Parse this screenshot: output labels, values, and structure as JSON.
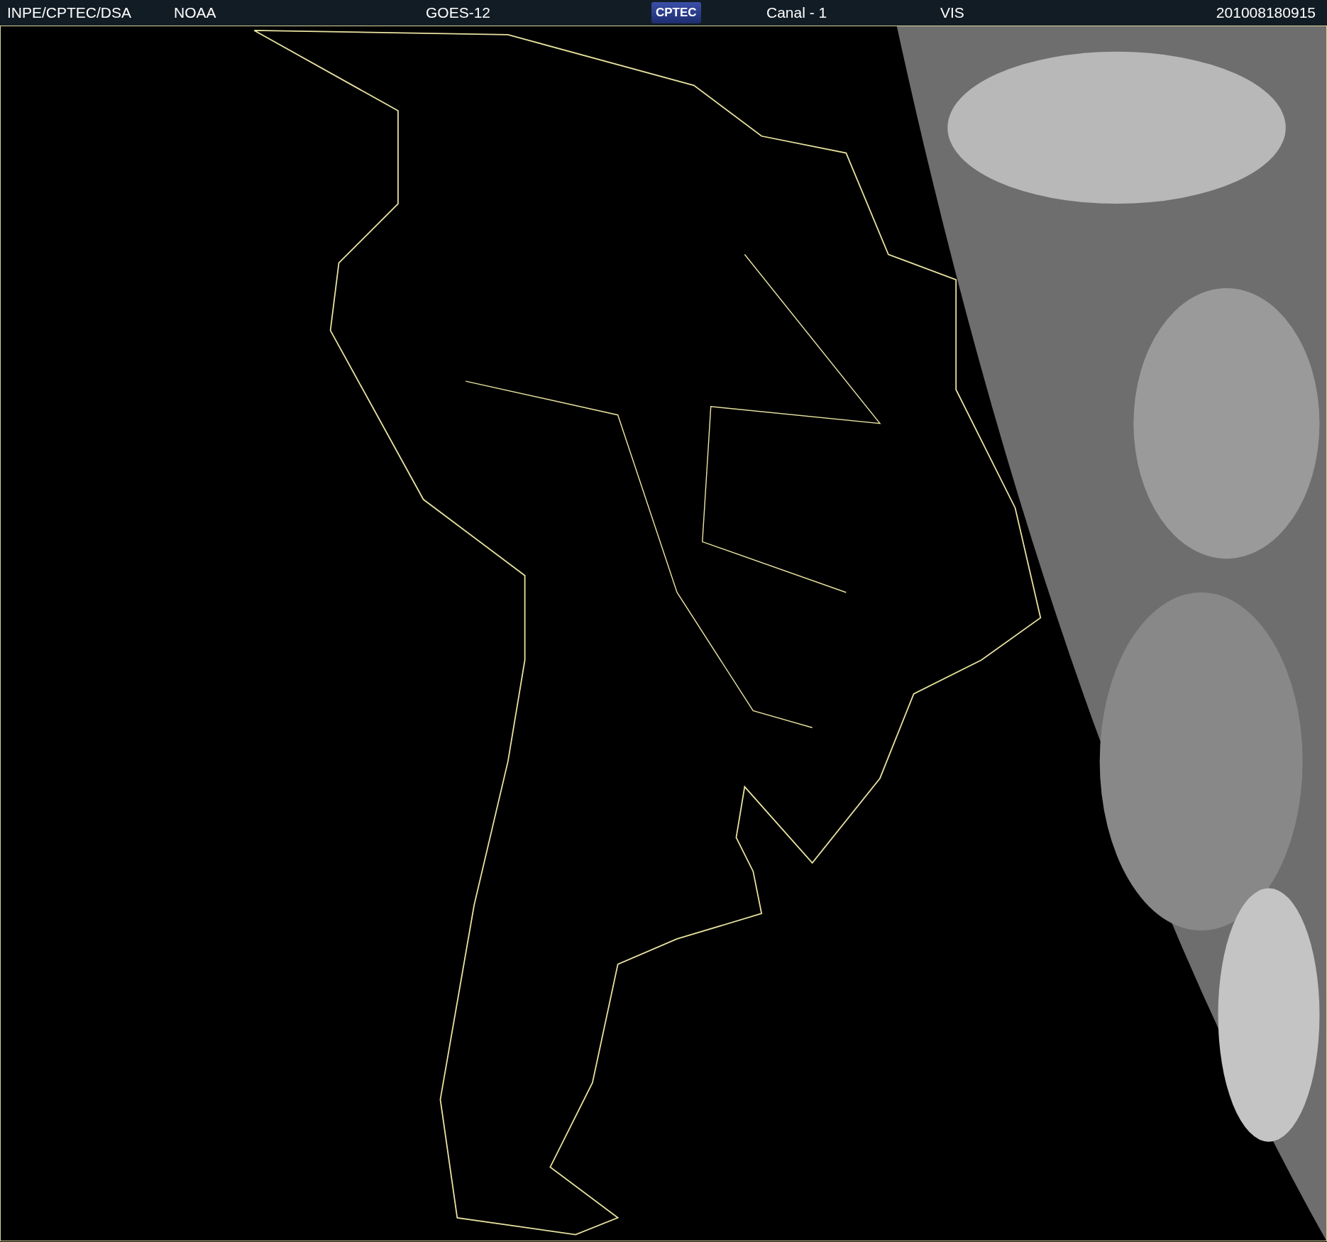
{
  "header": [
    {
      "kind": "text",
      "text": "INPE/CPTEC/DSA"
    },
    {
      "kind": "text",
      "text": "NOAA"
    },
    {
      "kind": "text",
      "text": "GOES-12"
    },
    {
      "kind": "logo",
      "text": "CPTEC"
    },
    {
      "kind": "text",
      "text": "Canal - 1"
    },
    {
      "kind": "text",
      "text": "VIS"
    },
    {
      "kind": "text",
      "text": "201008180915"
    }
  ]
}
